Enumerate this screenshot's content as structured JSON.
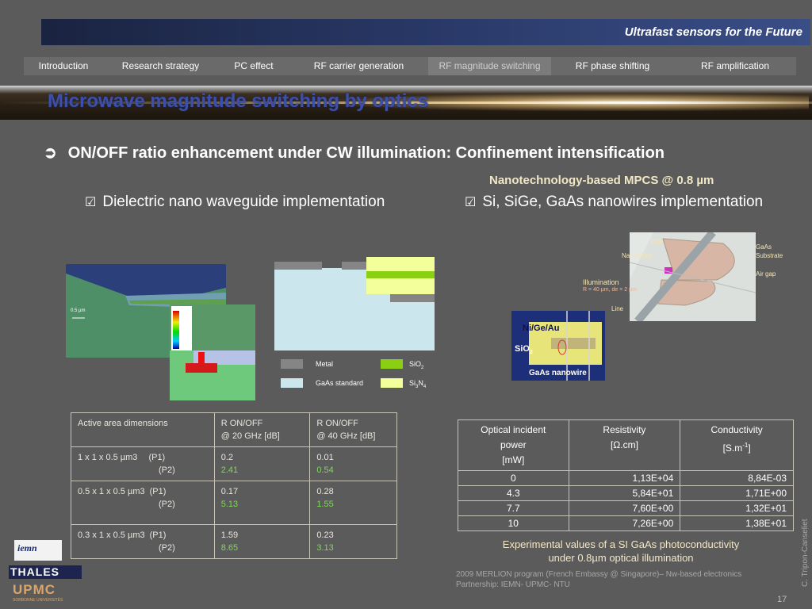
{
  "header": {
    "title": "Ultrafast sensors for the Future"
  },
  "nav": {
    "items": [
      {
        "label": "Introduction"
      },
      {
        "label": "Research strategy"
      },
      {
        "label": "PC effect"
      },
      {
        "label": "RF carrier generation"
      },
      {
        "label": "RF  magnitude switching"
      },
      {
        "label": "RF  phase shifting"
      },
      {
        "label": "RF  amplification"
      }
    ]
  },
  "slide": {
    "title": "Microwave magnitude switching by optics",
    "heading": "ON/OFF ratio enhancement under CW illumination: Confinement intensification",
    "heading_arrow": "➲",
    "nano_title": "Nanotechnology-based MPCS @ 0.8 µm",
    "bullet_left": "Dielectric nano waveguide  implementation",
    "bullet_right": "Si, SiGe, GaAs nanowires implementation",
    "checkbox": "☑"
  },
  "fig2_legend": {
    "metal": "Metal",
    "sio2": "SiO",
    "sio2_sub": "2",
    "gaas": "GaAs standard",
    "si3n4_a": "Si",
    "si3n4_b": "3",
    "si3n4_c": "N",
    "si3n4_d": "4"
  },
  "fig3_labels": {
    "line_top": "Line",
    "nanowire": "Nano-Wire",
    "gaas_sub_1": "GaAs",
    "gaas_sub_2": "Substrate",
    "airgap": "Air gap",
    "illumination": "Illumination",
    "illum_detail": "R = 40 µm, de = 2 µm",
    "line_bottom": "Line"
  },
  "fig4_labels": {
    "metal": "Ni/Ge/Au",
    "oxide": "SiO",
    "oxide_sub": "2",
    "nanowire": "GaAs nanowire"
  },
  "fig1_labels": {
    "scale": "0.5 µm"
  },
  "table1": {
    "headers": [
      "Active area dimensions",
      "R ON/OFF",
      "@ 20 GHz [dB]",
      "R ON/OFF",
      "@ 40 GHz [dB]"
    ],
    "rows": [
      {
        "dim": "1 x 1 x 0.5 µm3",
        "p1": "(P1)",
        "p2": "(P2)",
        "v20_1": "0.2",
        "v20_2": "2.41",
        "v40_1": "0.01",
        "v40_2": "0.54"
      },
      {
        "dim": "0.5 x 1 x 0.5 µm3",
        "p1": "(P1)",
        "p2": "(P2)",
        "v20_1": "0.17",
        "v20_2": "5.13",
        "v40_1": "0.28",
        "v40_2": "1.55"
      },
      {
        "dim": "0.3 x 1 x 0.5 µm3",
        "p1": "(P1)",
        "p2": "(P2)",
        "v20_1": "1.59",
        "v20_2": "8.65",
        "v40_1": "0.23",
        "v40_2": "3.13"
      }
    ]
  },
  "table2": {
    "headers": {
      "c1": [
        "Optical incident",
        "power",
        "[mW]"
      ],
      "c2": [
        "Resistivity",
        "[Ω.cm]"
      ],
      "c3a": "Conductivity",
      "c3b": "[S.m",
      "c3sup": "-1",
      "c3c": "]"
    },
    "rows": [
      {
        "power": "0",
        "res": "1,13E+04",
        "cond": "8,84E-03"
      },
      {
        "power": "4.3",
        "res": "5,84E+01",
        "cond": "1,71E+00"
      },
      {
        "power": "7.7",
        "res": "7,60E+00",
        "cond": "1,32E+01"
      },
      {
        "power": "10",
        "res": "7,26E+00",
        "cond": "1,38E+01"
      }
    ]
  },
  "caption": {
    "line1": "Experimental values of a SI GaAs photoconductivity",
    "line2": "under 0.8µm optical illumination"
  },
  "credit": {
    "line1": "2009 MERLION program (French Embassy @ Singapore)– Nw-based electronics",
    "line2": "Partnership: IEMN-  UPMC- NTU"
  },
  "author": "C. Tripon-Canseliet",
  "page_number": "17",
  "logos": {
    "iemn": "iemn",
    "thales": "THALES",
    "upmc": "UPMC",
    "upmc_sub": "SORBONNE UNIVERSITÉS"
  }
}
